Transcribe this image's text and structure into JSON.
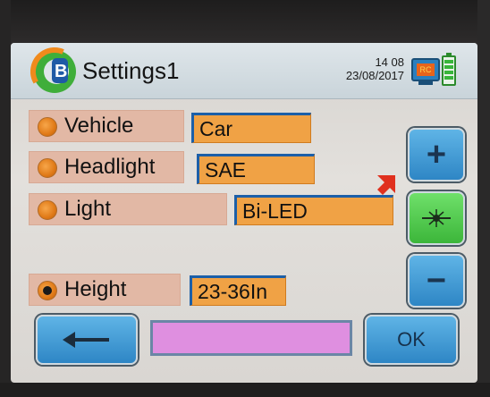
{
  "header": {
    "title": "Settings1",
    "time": "14 08",
    "date": "23/08/2017",
    "rec_label": "RC"
  },
  "rows": [
    {
      "label": "Vehicle",
      "value": "Car",
      "selected": false
    },
    {
      "label": "Headlight",
      "value": "SAE",
      "selected": false
    },
    {
      "label": "Light",
      "value": "Bi-LED",
      "selected": false
    },
    {
      "label": "Height",
      "value": "23-36In",
      "selected": true
    }
  ],
  "side_buttons": {
    "plus": "+",
    "center_icon": "light-burst-icon",
    "minus": "−"
  },
  "footer": {
    "back_icon": "back-arrow-icon",
    "ok": "OK"
  },
  "colors": {
    "accent_blue": "#2e86c5",
    "active_green": "#3cb63a",
    "value_orange": "#f0a245",
    "label_bg": "#e2b8a5",
    "message_pink": "#df8fe0",
    "indicator_red": "#e0301e"
  }
}
